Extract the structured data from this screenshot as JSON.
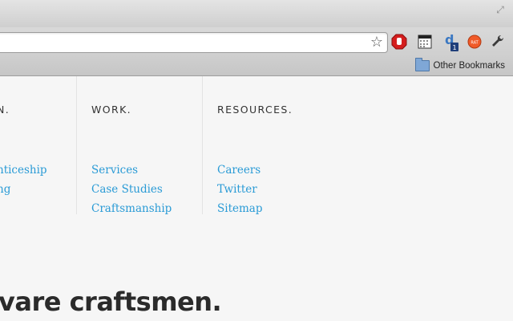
{
  "browser": {
    "bookmarks_bar": {
      "folder_label": "Other Bookmarks",
      "folder_icon": "folder-icon"
    },
    "toolbar_icons": [
      "star-icon",
      "stop-sign-icon",
      "calendar-icon",
      "delicious-icon",
      "ratings-badge-icon",
      "wrench-icon"
    ],
    "extension_badges": {
      "delicious": "1",
      "ratings": "RAT"
    }
  },
  "footer_nav": {
    "columns": [
      {
        "heading": "N.",
        "links": [
          "nticeship",
          "ng"
        ]
      },
      {
        "heading": "WORK.",
        "links": [
          "Services",
          "Case Studies",
          "Craftsmanship"
        ]
      },
      {
        "heading": "RESOURCES.",
        "links": [
          "Careers",
          "Twitter",
          "Sitemap"
        ]
      }
    ],
    "link_color": "#2a9bd6"
  },
  "headline": "vare craftsmen."
}
